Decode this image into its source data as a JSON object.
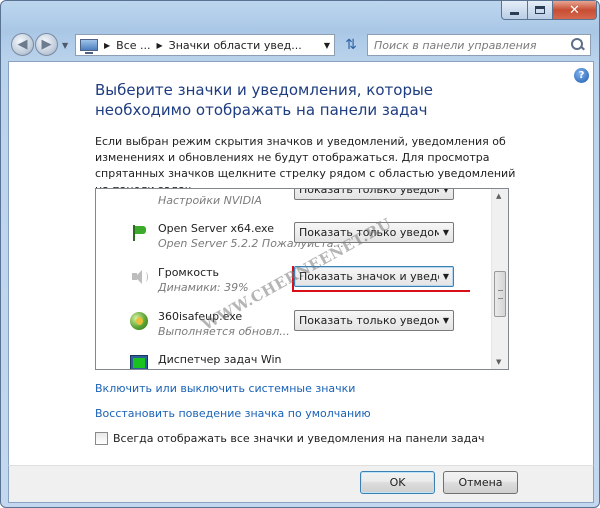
{
  "window": {
    "caption_min": "",
    "caption_max": "",
    "caption_close": "✕"
  },
  "nav": {
    "breadcrumb": [
      "Все ...",
      "Значки области увед..."
    ],
    "search_placeholder": "Поиск в панели управления"
  },
  "content": {
    "heading": "Выберите значки и уведомления, которые необходимо отображать на панели задач",
    "description": "Если выбран режим скрытия значков и уведомлений, уведомления об изменениях и обновлениях не будут отображаться. Для просмотра спрятанных значков щелкните стрелку рядом с областью уведомлений на панели задач.",
    "items": [
      {
        "name": "",
        "sub": "Настройки NVIDIA",
        "behavior": "Показать только уведомле",
        "icon": "nvidia-icon"
      },
      {
        "name": "Open Server x64.exe",
        "sub": "Open Server 5.2.2  Пожалуйста...",
        "behavior": "Показать только уведомле",
        "icon": "flag-icon"
      },
      {
        "name": "Громкость",
        "sub": "Динамики: 39%",
        "behavior": "Показать значок и уведомл",
        "icon": "speaker-icon"
      },
      {
        "name": "360isafeup.exe",
        "sub": "Выполняется обновл...",
        "behavior": "Показать только уведомле",
        "icon": "globe-icon"
      },
      {
        "name": "Диспетчер задач Win",
        "sub": "",
        "behavior": "",
        "icon": "taskmgr-icon"
      }
    ],
    "watermark": "WWW.CHERNEENET.RU",
    "link_system_icons": "Включить или выключить системные значки",
    "link_restore_defaults": "Восстановить поведение значка по умолчанию",
    "always_show_label": "Всегда отображать все значки и уведомления на панели задач"
  },
  "buttons": {
    "ok": "OK",
    "cancel": "Отмена"
  },
  "colors": {
    "heading": "#1e3c80",
    "link": "#1a62b5",
    "highlight_line": "#d80e18"
  }
}
